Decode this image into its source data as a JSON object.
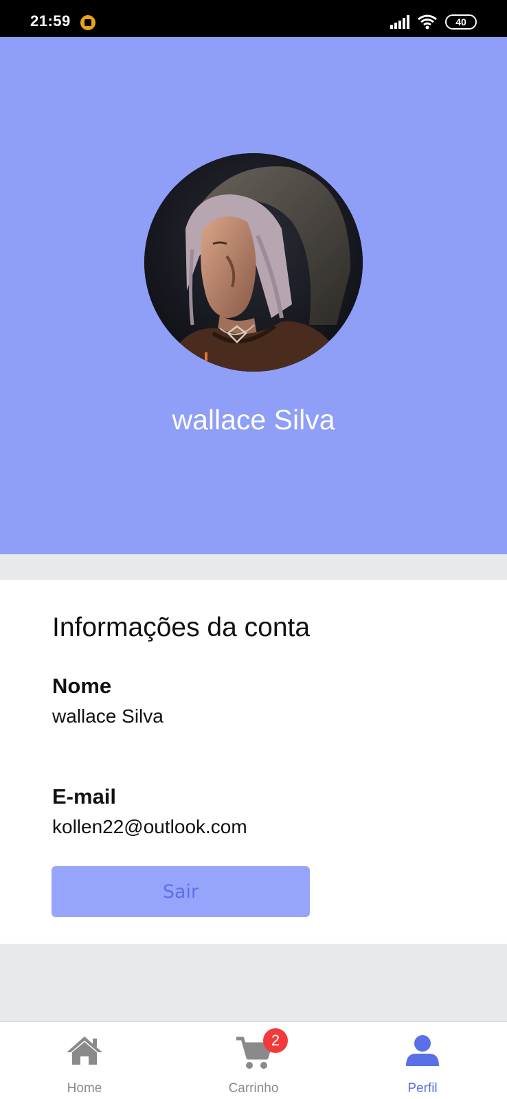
{
  "status_bar": {
    "time": "21:59",
    "battery": "40",
    "icons": [
      "app-notification-icon",
      "signal-icon",
      "wifi-icon",
      "battery-icon"
    ]
  },
  "profile": {
    "name": "wallace Silva",
    "avatar": "user-avatar-photo"
  },
  "account_info": {
    "title": "Informações da conta",
    "name_label": "Nome",
    "name_value": "wallace Silva",
    "email_label": "E-mail",
    "email_value": "kollen22@outlook.com",
    "logout_label": "Sair"
  },
  "bottom_nav": {
    "items": [
      {
        "label": "Home",
        "icon": "home-icon",
        "active": false
      },
      {
        "label": "Carrinho",
        "icon": "cart-icon",
        "active": false,
        "badge": "2"
      },
      {
        "label": "Perfil",
        "icon": "user-icon",
        "active": true
      }
    ]
  },
  "colors": {
    "header_bg": "#8f9ef6",
    "button_bg": "#97a4fb",
    "button_text": "#5a70e8",
    "nav_active": "#5a70e8",
    "nav_inactive": "#8a8a8a",
    "badge": "#f23a3a",
    "page_bg": "#e8e9eb"
  }
}
